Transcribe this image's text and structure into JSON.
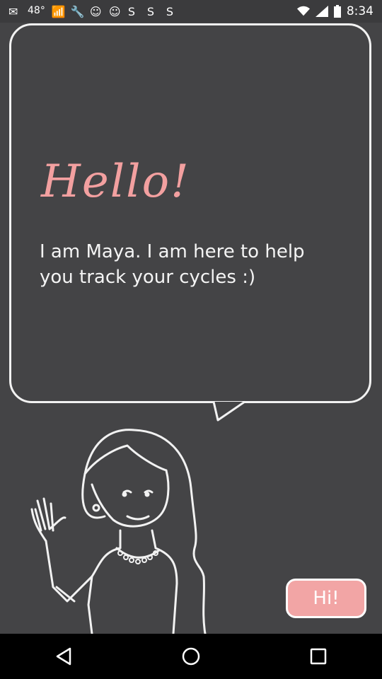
{
  "status_bar": {
    "time": "8:34",
    "badge": "48°"
  },
  "bubble": {
    "greeting": "Hello!",
    "message": "I am Maya. I am here to help you track your cycles :)"
  },
  "button": {
    "label": "Hi!"
  },
  "colors": {
    "background": "#444446",
    "accent": "#f2a5a5",
    "greeting": "#f3a0a0"
  },
  "icons": [
    "back-icon",
    "home-icon",
    "recents-icon"
  ]
}
